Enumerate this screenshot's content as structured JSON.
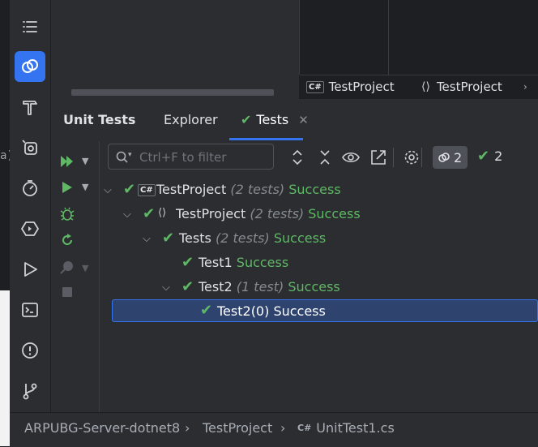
{
  "left_strip": {
    "glyph": "a)"
  },
  "toolbar": {
    "items": [
      {
        "icon": "list-icon"
      },
      {
        "icon": "unit-tests-icon",
        "active": true
      },
      {
        "icon": "hammer-icon"
      },
      {
        "icon": "services-icon"
      },
      {
        "icon": "dotmemory-icon"
      },
      {
        "icon": "debug-hexagon-icon"
      },
      {
        "icon": "run-icon"
      },
      {
        "icon": "terminal-icon"
      },
      {
        "icon": "problems-icon"
      },
      {
        "icon": "git-icon"
      }
    ]
  },
  "top_tabs": [
    {
      "badge": "C#",
      "label": "TestProject"
    },
    {
      "badge": "⟨⟩",
      "label": "TestProject"
    }
  ],
  "panel": {
    "title": "Unit Tests",
    "tabs": [
      {
        "label": "Explorer"
      },
      {
        "label": "Tests",
        "active": true,
        "closable": true
      }
    ]
  },
  "filter": {
    "placeholder": "Ctrl+F to filter",
    "value": ""
  },
  "counters": {
    "total": "2",
    "passed": "2"
  },
  "tree": [
    {
      "depth": 0,
      "expanded": true,
      "icon": "C#",
      "name": "TestProject",
      "count": "(2 tests)",
      "status": "Success"
    },
    {
      "depth": 1,
      "expanded": true,
      "icon": "⟨⟩",
      "name": "TestProject",
      "count": "(2 tests)",
      "status": "Success"
    },
    {
      "depth": 2,
      "expanded": true,
      "icon": "",
      "name": "Tests",
      "count": "(2 tests)",
      "status": "Success"
    },
    {
      "depth": 3,
      "expanded": null,
      "icon": "",
      "name": "Test1",
      "count": "",
      "status": "Success"
    },
    {
      "depth": 3,
      "expanded": true,
      "icon": "",
      "name": "Test2",
      "count": "(1 test)",
      "status": "Success"
    },
    {
      "depth": 4,
      "expanded": null,
      "icon": "",
      "name": "Test2(0) Success",
      "count": "",
      "status": "",
      "selected": true
    }
  ],
  "breadcrumb": [
    {
      "label": "ARPUBG-Server-dotnet8"
    },
    {
      "label": "TestProject"
    },
    {
      "badge": "C#",
      "label": "UnitTest1.cs"
    }
  ],
  "colors": {
    "accent": "#3574f0",
    "success": "#5fb865",
    "selection": "#2e436e"
  }
}
